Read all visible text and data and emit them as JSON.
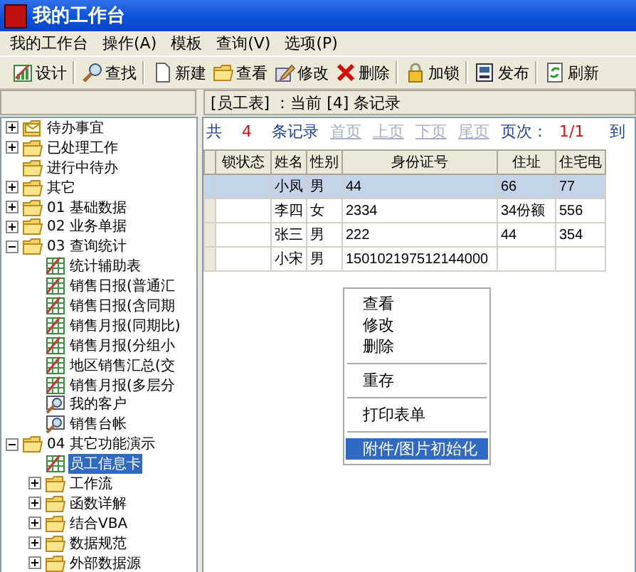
{
  "window": {
    "title": "我的工作台"
  },
  "menu": [
    "我的工作台",
    "操作(A)",
    "模板",
    "查询(V)",
    "选项(P)"
  ],
  "toolbar": [
    [
      {
        "label": "设计",
        "kind": "chart"
      }
    ],
    [
      {
        "label": "查找",
        "kind": "search"
      }
    ],
    [
      {
        "label": "新建",
        "kind": "page"
      },
      {
        "label": "查看",
        "kind": "folder"
      },
      {
        "label": "修改",
        "kind": "edit"
      },
      {
        "label": "删除",
        "kind": "delete"
      }
    ],
    [
      {
        "label": "加锁",
        "kind": "lock"
      }
    ],
    [
      {
        "label": "发布",
        "kind": "publish"
      }
    ],
    [
      {
        "label": "刷新",
        "kind": "refresh"
      }
    ]
  ],
  "status": {
    "text": "[员工表] ：当前 [4] 条记录"
  },
  "tree": [
    {
      "label": "待办事宜",
      "kind": "mail-folder",
      "expanded": false
    },
    {
      "label": "已处理工作",
      "kind": "folder",
      "expanded": false
    },
    {
      "label": "进行中待办",
      "kind": "folder"
    },
    {
      "label": "其它",
      "kind": "folder",
      "expanded": false
    },
    {
      "label": "01 基础数据",
      "kind": "folder",
      "expanded": false
    },
    {
      "label": "02 业务单据",
      "kind": "folder",
      "expanded": false
    },
    {
      "label": "03 查询统计",
      "kind": "folder",
      "expanded": true,
      "children": [
        {
          "label": "统计辅助表",
          "kind": "report",
          "selected": false
        },
        {
          "label": "销售日报(普通汇",
          "kind": "report",
          "selected": false
        },
        {
          "label": "销售日报(含同期",
          "kind": "report",
          "selected": false
        },
        {
          "label": "销售月报(同期比)",
          "kind": "report",
          "selected": false
        },
        {
          "label": "销售月报(分组小",
          "kind": "report",
          "selected": false
        },
        {
          "label": "地区销售汇总(交",
          "kind": "report",
          "selected": false
        },
        {
          "label": "销售月报(多层分",
          "kind": "report",
          "selected": false
        },
        {
          "label": "我的客户",
          "kind": "query",
          "selected": false
        },
        {
          "label": "销售台帐",
          "kind": "query",
          "selected": false
        }
      ]
    },
    {
      "label": "04 其它功能演示",
      "kind": "folder",
      "expanded": true,
      "children": [
        {
          "label": "员工信息卡",
          "kind": "report",
          "selected": true
        },
        {
          "label": "工作流",
          "kind": "folder",
          "expanded": false
        },
        {
          "label": "函数详解",
          "kind": "folder",
          "expanded": false
        },
        {
          "label": "结合VBA",
          "kind": "folder",
          "expanded": false
        },
        {
          "label": "数据规范",
          "kind": "folder",
          "expanded": false
        },
        {
          "label": "外部数据源",
          "kind": "folder",
          "expanded": false
        }
      ]
    }
  ],
  "pager": {
    "total_label": "共",
    "total": "4",
    "records_label": "条记录",
    "links": [
      {
        "label": "首页",
        "disabled": true
      },
      {
        "label": "上页",
        "disabled": true
      },
      {
        "label": "下页",
        "disabled": true
      },
      {
        "label": "尾页",
        "disabled": true
      }
    ],
    "page_label": "页次：",
    "page": "1/1",
    "goto_label": "到"
  },
  "table": {
    "columns": [
      "锁状态",
      "姓名",
      "性别",
      "身份证号",
      "住址",
      "住宅电"
    ],
    "rows": [
      {
        "cells": [
          "",
          "小凤",
          "男",
          "44",
          "66",
          "77"
        ],
        "selected": true
      },
      {
        "cells": [
          "",
          "李四",
          "女",
          "2334",
          "34份额",
          "556"
        ],
        "selected": false
      },
      {
        "cells": [
          "",
          "张三",
          "男",
          "222",
          "44",
          "354"
        ],
        "selected": false
      },
      {
        "cells": [
          "",
          "小宋",
          "男",
          "150102197512144000",
          "",
          ""
        ],
        "selected": false
      }
    ]
  },
  "context_menu": [
    [
      {
        "label": "查看",
        "selected": false
      },
      {
        "label": "修改",
        "selected": false
      },
      {
        "label": "删除",
        "selected": false
      }
    ],
    [
      {
        "label": "重存",
        "selected": false
      }
    ],
    [
      {
        "label": "打印表单",
        "selected": false
      }
    ],
    [
      {
        "label": "附件/图片初始化",
        "selected": true
      }
    ]
  ]
}
